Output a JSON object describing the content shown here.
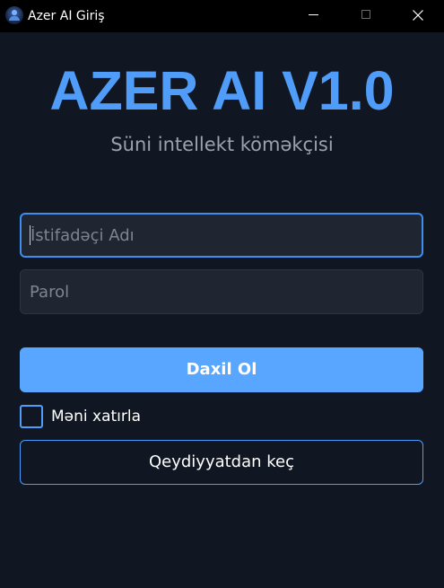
{
  "window": {
    "title": "Azer AI Giriş"
  },
  "header": {
    "title": "AZER AI V1.0",
    "subtitle": "Süni intellekt köməkçisi"
  },
  "form": {
    "username": {
      "placeholder": "İstifadəçi Adı",
      "value": ""
    },
    "password": {
      "placeholder": "Parol",
      "value": ""
    },
    "login_label": "Daxil Ol",
    "remember_label": "Məni xatırla",
    "remember_checked": false,
    "register_label": "Qeydiyyatdan keç"
  },
  "colors": {
    "accent": "#4f9cf9",
    "button": "#58a6ff",
    "background": "#111722",
    "input_bg": "#1f2631"
  }
}
